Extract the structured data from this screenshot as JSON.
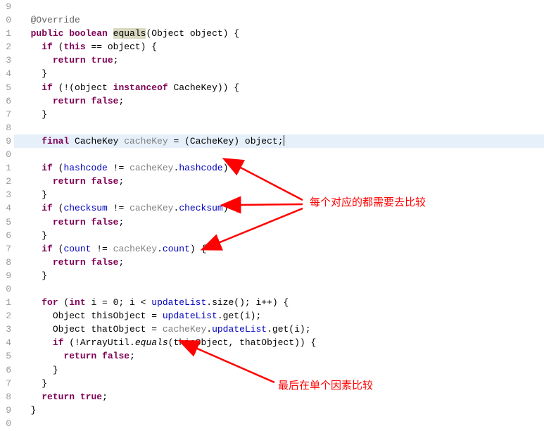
{
  "gutter": [
    "9",
    "0",
    "1",
    "2",
    "3",
    "4",
    "5",
    "6",
    "7",
    "8",
    "9",
    "0",
    "1",
    "2",
    "3",
    "4",
    "5",
    "6",
    "7",
    "8",
    "9",
    "0",
    "1",
    "2",
    "3",
    "4",
    "5",
    "6",
    "7",
    "8",
    "9",
    "0"
  ],
  "lines": {
    "l0": "  ",
    "l1_ann": "@Override",
    "l2_pub": "public",
    "l2_bool": "boolean",
    "l2_eq": "equals",
    "l2_rest": "(Object object) {",
    "l3_if": "if",
    "l3_this": "this",
    "l3_rest": " == object) {",
    "l4_return": "return",
    "l4_true": "true",
    "l5_brace": "}",
    "l6_if": "if",
    "l6_rest1": " (!(object ",
    "l6_inst": "instanceof",
    "l6_rest2": " CacheKey)) {",
    "l7_return": "return",
    "l7_false": "false",
    "l8_brace": "}",
    "l9_empty": "",
    "l10_final": "final",
    "l10_rest1": " CacheKey ",
    "l10_var": "cacheKey",
    "l10_rest2": " = (CacheKey) object;",
    "l11_empty": "",
    "l12_if": "if",
    "l12_f1": "hashcode",
    "l12_ne": " != ",
    "l12_var": "cacheKey",
    "l12_dot": ".",
    "l12_f2": "hashcode",
    "l12_end": ") {",
    "l13_return": "return",
    "l13_false": "false",
    "l14_brace": "}",
    "l15_if": "if",
    "l15_f1": "checksum",
    "l15_var": "cacheKey",
    "l15_f2": "checksum",
    "l16_return": "return",
    "l16_false": "false",
    "l17_brace": "}",
    "l18_if": "if",
    "l18_f1": "count",
    "l18_var": "cacheKey",
    "l18_f2": "count",
    "l19_return": "return",
    "l19_false": "false",
    "l20_brace": "}",
    "l21_empty": "",
    "l22_for": "for",
    "l22_int": "int",
    "l22_rest1": " i = 0; i < ",
    "l22_f": "updateList",
    "l22_rest2": ".size(); i++) {",
    "l23_rest1": "Object thisObject = ",
    "l23_f": "updateList",
    "l23_rest2": ".get(i);",
    "l24_rest1": "Object thatObject = ",
    "l24_var": "cacheKey",
    "l24_dot": ".",
    "l24_f": "updateList",
    "l24_rest2": ".get(i);",
    "l25_if": "if",
    "l25_rest1": " (!ArrayUtil.",
    "l25_eq": "equals",
    "l25_rest2": "(thisObject, thatObject)) {",
    "l26_return": "return",
    "l26_false": "false",
    "l27_brace": "}",
    "l28_brace": "}",
    "l29_return": "return",
    "l29_true": "true",
    "l30_brace": "}"
  },
  "annotations": {
    "a1": "每个对应的都需要去比较",
    "a2": "最后在单个因素比较"
  }
}
